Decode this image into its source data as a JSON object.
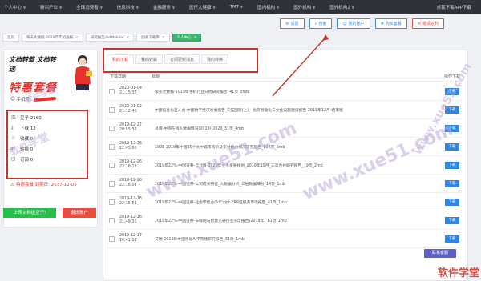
{
  "topnav": {
    "items": [
      {
        "label": "个人中心"
      },
      {
        "label": "新兴产业"
      },
      {
        "label": "全球消费者"
      },
      {
        "label": "信息科技"
      },
      {
        "label": "金融服务"
      },
      {
        "label": "医疗大健康"
      },
      {
        "label": "TMT"
      },
      {
        "label": "国内机构"
      },
      {
        "label": "国外机构"
      },
      {
        "label": "国外机构2"
      }
    ],
    "app_download": "点我下载APP下载"
  },
  "tabs": [
    {
      "label": "首页"
    },
    {
      "label": "每天大数据-2019年年机器报"
    },
    {
      "label": "研究报告/AdMobile/"
    },
    {
      "label": "图表下载库"
    },
    {
      "label": "个人中心"
    }
  ],
  "actions": [
    {
      "label": "设置",
      "icon": "gear-icon"
    },
    {
      "label": "搜索",
      "icon": "search-icon"
    },
    {
      "label": "我的账户",
      "icon": "user-icon"
    },
    {
      "label": "购买套餐",
      "icon": "cart-icon"
    },
    {
      "label": "邀请返利",
      "icon": "gift-icon"
    }
  ],
  "promo": {
    "line1": "文档转载 文档转送",
    "line2": "特惠套餐"
  },
  "member": {
    "label": "手机号:"
  },
  "stats": [
    {
      "label": "豆子 2160",
      "icon": "bean-icon"
    },
    {
      "label": "下载 12",
      "icon": "download-icon"
    },
    {
      "label": "收藏 0",
      "icon": "star-icon"
    },
    {
      "label": "转换 0",
      "icon": "convert-icon"
    },
    {
      "label": "订阅 0",
      "icon": "subscribe-icon"
    }
  ],
  "expire": "特惠套餐 到期日: 2037-12-05",
  "upload_btn": "上传文档送豆子!",
  "logout_btn": "退出账户",
  "subtabs": [
    {
      "label": "我的下载",
      "active": true
    },
    {
      "label": "我的收藏",
      "active": false
    },
    {
      "label": "订阅更新消息",
      "active": false
    },
    {
      "label": "我的转换",
      "active": false
    }
  ],
  "table": {
    "headers": {
      "date": "下载日期",
      "title": "标题",
      "op": "操作下载"
    },
    "rows": [
      {
        "date": "2020-01-04",
        "time": "21:15:37",
        "title": "极光大数据-2019年手机行业分析研究报告_41页_3mb",
        "btn": "下载"
      },
      {
        "date": "2020-01-02",
        "time": "21:12:45",
        "title": "中国信息化百人会:中国数字经济发展报告 天猫国际(上) - 北京智能化与文化设施建设报告-2019年12月-结束版",
        "btn": "下载"
      },
      {
        "date": "2019-12-27",
        "time": "20:55:38",
        "title": "易观-中国在线人数据情况(2019)(2020_31页_4mb",
        "btn": "下载"
      },
      {
        "date": "2019-12-26",
        "time": "22:45:00",
        "title": "1998-2019年中国30个大中城市房价及支付能力情况研究报告_104页_6mb",
        "btn": "下载"
      },
      {
        "date": "2019-12-26",
        "time": "22:16:13",
        "title": "2019年22%-中国证券-云计算-2020年业务发展规划_2019年10月_三高合并研究报告_19页_2mb",
        "btn": "下载"
      },
      {
        "date": "2019-12-26",
        "time": "22:16:03",
        "title": "2019年22%-中国证券-公司成长特征_大数据分析_三层数据细分_14页_1mb",
        "btn": "下载"
      },
      {
        "date": "2019-12-26",
        "time": "22:15:53",
        "title": "2019年22%-中国证券-社会零售业(5年)ppt-ERP后服务市场报告_41页_1mb",
        "btn": "下载"
      },
      {
        "date": "2019-12-26",
        "time": "21:49:35",
        "title": "2019年22%-中国证券-车联网与智慧交通行业深度报告(2019年)_61页_1mb",
        "btn": "下载"
      },
      {
        "date": "2019-12-17",
        "time": "16:41:03",
        "title": "艾瑞-2019年中国移动APP市场研究报告_31页_1mb",
        "btn": "下载"
      }
    ]
  },
  "contact_btn": "联系客服",
  "watermarks": [
    "软件学堂",
    "www.xue51.com",
    "软件学堂",
    "www.xue51.com",
    "www.xue51.com"
  ],
  "brand_logo": "软件学堂"
}
